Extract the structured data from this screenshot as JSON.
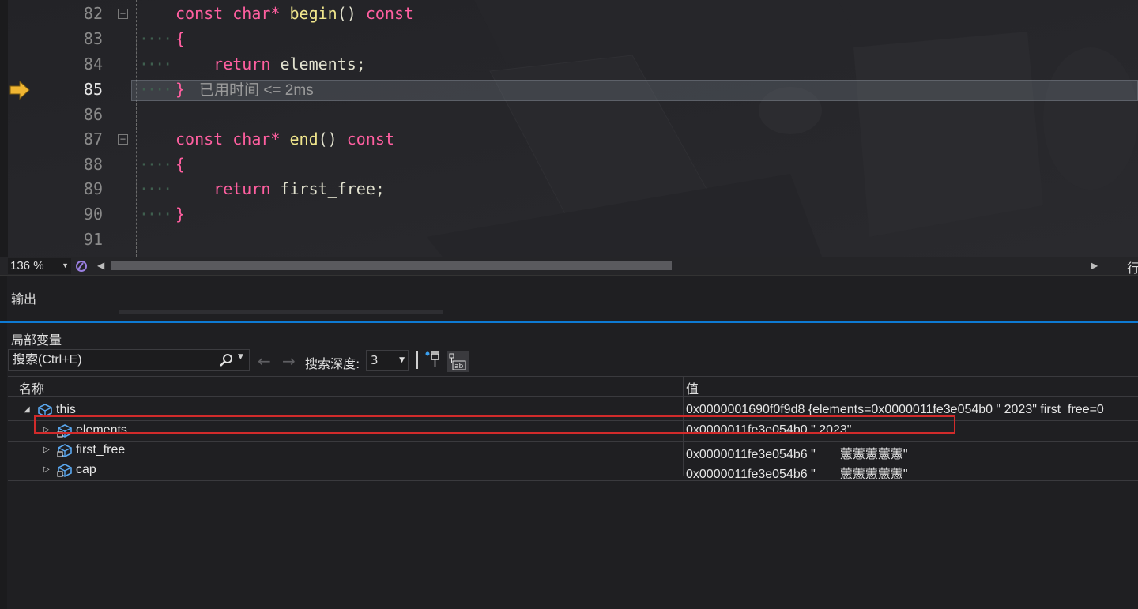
{
  "editor": {
    "lines": [
      {
        "num": "82",
        "tokens": [
          {
            "t": "const ",
            "c": "kw"
          },
          {
            "t": "char* ",
            "c": "kw"
          },
          {
            "t": "begin",
            "c": "fn"
          },
          {
            "t": "() ",
            "c": "id"
          },
          {
            "t": "const",
            "c": "kw"
          }
        ],
        "fold": "−"
      },
      {
        "num": "83",
        "tokens": [
          {
            "t": "{",
            "c": "br"
          }
        ]
      },
      {
        "num": "84",
        "tokens": [
          {
            "t": "    return ",
            "c": "kw"
          },
          {
            "t": "elements",
            "c": "id"
          },
          {
            "t": ";",
            "c": "id"
          }
        ]
      },
      {
        "num": "85",
        "tokens": [
          {
            "t": "}",
            "c": "br"
          }
        ],
        "current": true
      },
      {
        "num": "86",
        "tokens": []
      },
      {
        "num": "87",
        "tokens": [
          {
            "t": "const ",
            "c": "kw"
          },
          {
            "t": "char* ",
            "c": "kw"
          },
          {
            "t": "end",
            "c": "fn"
          },
          {
            "t": "() ",
            "c": "id"
          },
          {
            "t": "const",
            "c": "kw"
          }
        ],
        "fold": "−"
      },
      {
        "num": "88",
        "tokens": [
          {
            "t": "{",
            "c": "br"
          }
        ]
      },
      {
        "num": "89",
        "tokens": [
          {
            "t": "    return ",
            "c": "kw"
          },
          {
            "t": "first_free",
            "c": "id"
          },
          {
            "t": ";",
            "c": "id"
          }
        ]
      },
      {
        "num": "90",
        "tokens": [
          {
            "t": "}",
            "c": "br"
          }
        ]
      },
      {
        "num": "91",
        "tokens": []
      }
    ],
    "elapsed_text": "已用时间 <= 2ms",
    "zoom": "136 %",
    "column_label": "行"
  },
  "output": {
    "title": "输出"
  },
  "locals": {
    "title": "局部变量",
    "search_placeholder": "搜索(Ctrl+E)",
    "depth_label": "搜索深度:",
    "depth_value": "3",
    "col_name": "名称",
    "col_value": "值",
    "rows": [
      {
        "name": "this",
        "value": "0x0000001690f0f9d8 {elements=0x0000011fe3e054b0 \" 2023\" first_free=0",
        "expanded": true,
        "level": 0
      },
      {
        "name": "elements",
        "value": "0x0000011fe3e054b0 \" 2023\"",
        "expanded": false,
        "level": 1
      },
      {
        "name": "first_free",
        "value": "0x0000011fe3e054b6 \"       藼藼藼藼藼\"",
        "expanded": false,
        "level": 1
      },
      {
        "name": "cap",
        "value": "0x0000011fe3e054b6 \"       藼藼藼藼藼\"",
        "expanded": false,
        "level": 1
      }
    ]
  },
  "colors": {
    "accent": "#0e7ad3",
    "selection_border": "#d12b2b",
    "keyword": "#ff5fa0",
    "function": "#f0e68c"
  }
}
